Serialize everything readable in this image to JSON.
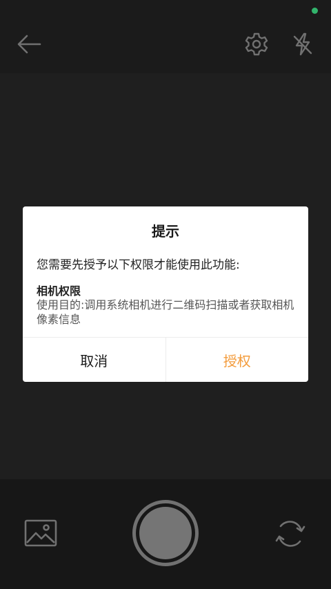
{
  "colors": {
    "status_dot": "#3ddc84",
    "accent": "#f39b3b",
    "icon": "#8a8a8a"
  },
  "top_bar": {
    "back_icon": "arrow-left-icon",
    "settings_icon": "gear-icon",
    "flash_icon": "flash-off-icon"
  },
  "bottom_bar": {
    "gallery_icon": "image-icon",
    "shutter_icon": "shutter-icon",
    "switch_icon": "camera-switch-icon"
  },
  "dialog": {
    "title": "提示",
    "message": "您需要先授予以下权限才能使用此功能:",
    "permission_name": "相机权限",
    "permission_desc": "使用目的:调用系统相机进行二维码扫描或者获取相机像素信息",
    "cancel_label": "取消",
    "confirm_label": "授权"
  }
}
